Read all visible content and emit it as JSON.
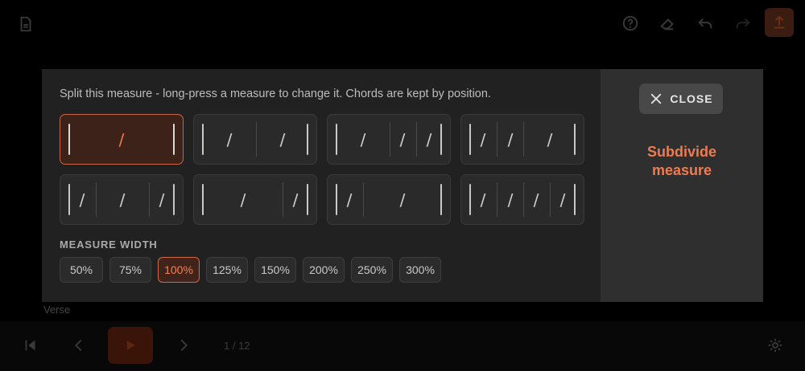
{
  "background": {
    "top_icons": [
      "pdf-icon",
      "help-icon",
      "eraser-icon",
      "undo-icon",
      "redo-icon",
      "export-icon"
    ],
    "section_label": "Verse",
    "page_indicator": "1 / 12"
  },
  "dialog": {
    "instructions": "Split this measure - long-press a measure to change it. Chords are kept by position.",
    "options": [
      {
        "id": "whole",
        "selected": true
      },
      {
        "id": "halves"
      },
      {
        "id": "half-quarter-quarter"
      },
      {
        "id": "quarter-quarter-half"
      },
      {
        "id": "quarter-half-quarter"
      },
      {
        "id": "dotted-half-quarter"
      },
      {
        "id": "quarter-dotted-half"
      },
      {
        "id": "four-quarters"
      }
    ],
    "slash_char": "/",
    "measure_width_label": "MEASURE WIDTH",
    "widths": [
      "50%",
      "75%",
      "100%",
      "125%",
      "150%",
      "200%",
      "250%",
      "300%"
    ],
    "selected_width": "100%",
    "close_label": "CLOSE",
    "side_title_line1": "Subdivide",
    "side_title_line2": "measure"
  },
  "colors": {
    "accent": "#f07b4f",
    "selected_bg": "#3d2219",
    "dialog_bg": "#212121",
    "sidebar_bg": "#2f2f2f"
  }
}
